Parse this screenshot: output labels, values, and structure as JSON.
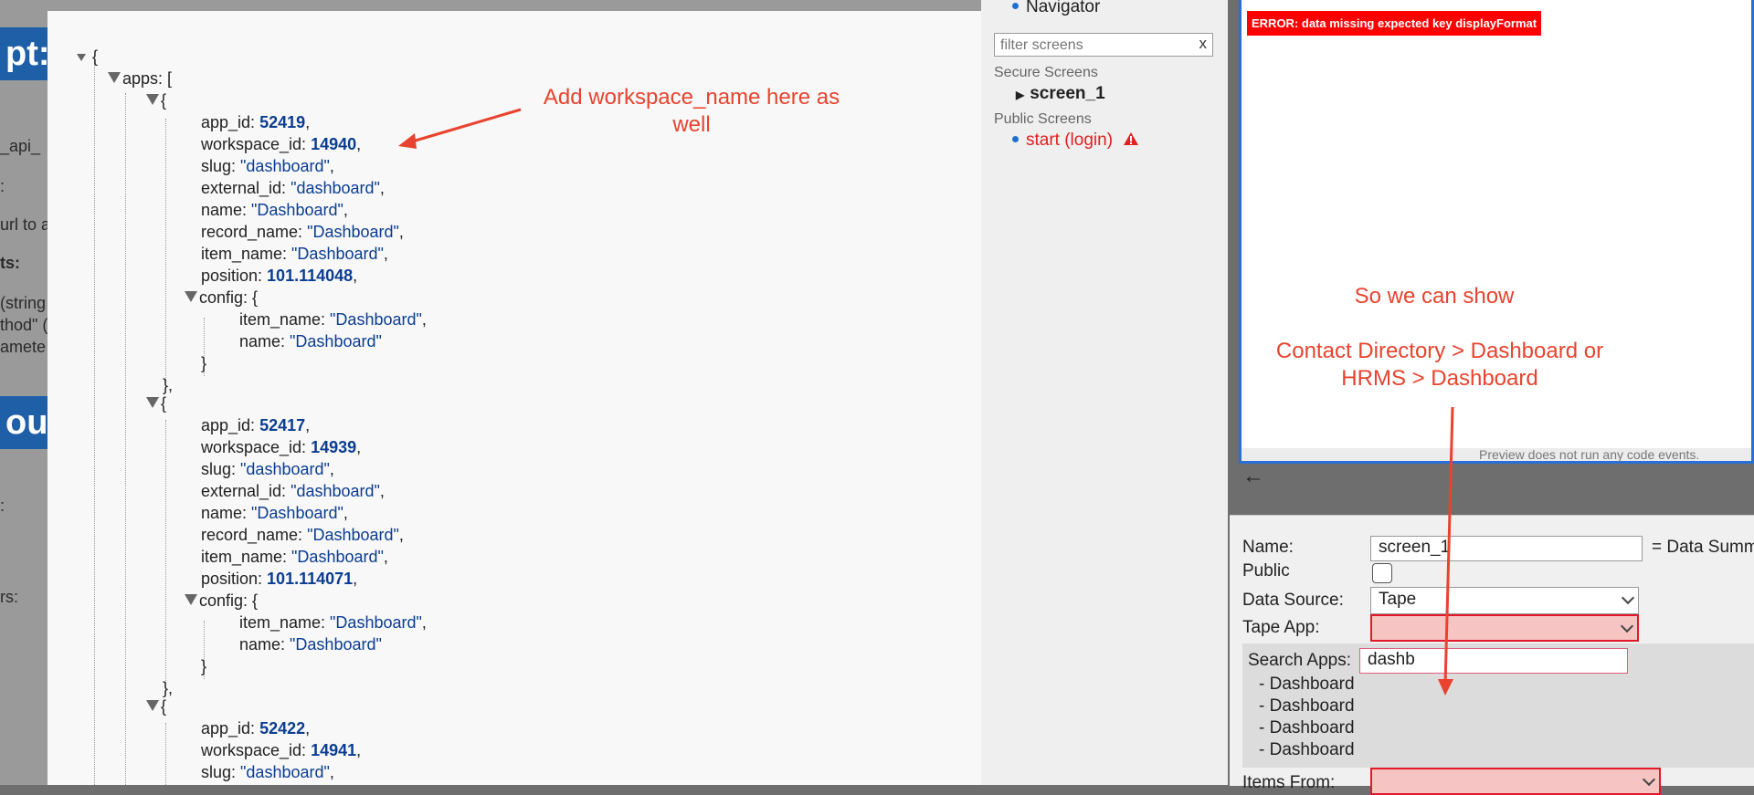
{
  "background": {
    "headings": [
      "pt:",
      "out"
    ],
    "fragments": [
      "_api_",
      ":",
      "url to a",
      "ts:",
      "(string",
      "thod\" (",
      "amete",
      ":",
      "rs:"
    ]
  },
  "json_view": {
    "open_brace": "{",
    "apps_key": "apps: [",
    "records": [
      {
        "app_id": "52419",
        "workspace_id": "14940",
        "slug": "\"dashboard\"",
        "external_id": "\"dashboard\"",
        "name": "\"Dashboard\"",
        "record_name": "\"Dashboard\"",
        "item_name": "\"Dashboard\"",
        "position": "101.114048",
        "config_item_name": "\"Dashboard\"",
        "config_name": "\"Dashboard\""
      },
      {
        "app_id": "52417",
        "workspace_id": "14939",
        "slug": "\"dashboard\"",
        "external_id": "\"dashboard\"",
        "name": "\"Dashboard\"",
        "record_name": "\"Dashboard\"",
        "item_name": "\"Dashboard\"",
        "position": "101.114071",
        "config_item_name": "\"Dashboard\"",
        "config_name": "\"Dashboard\""
      },
      {
        "app_id": "52422",
        "workspace_id": "14941",
        "slug": "\"dashboard\""
      }
    ]
  },
  "annotations": {
    "workspace_note_line1": "Add workspace_name here as",
    "workspace_note_line2": "well",
    "show_note": "So we can show",
    "example_line1": "Contact Directory > Dashboard or",
    "example_line2": "HRMS > Dashboard"
  },
  "navigator": {
    "title": "Navigator",
    "filter_placeholder": "filter screens",
    "filter_clear": "x",
    "secure_label": "Secure Screens",
    "secure_screens": [
      "screen_1"
    ],
    "public_label": "Public Screens",
    "public_screens": [
      "start (login)"
    ],
    "warning_icon": "warning-icon"
  },
  "preview": {
    "error": "ERROR: data missing expected key displayFormat",
    "footer": "Preview does not run any code events."
  },
  "properties": {
    "name_label": "Name:",
    "name_value": "screen_1",
    "name_suffix": "= Data Summ",
    "public_label": "Public",
    "data_source_label": "Data Source:",
    "data_source_value": "Tape",
    "tape_app_label": "Tape App:",
    "search_apps_label": "Search Apps:",
    "search_apps_value": "dashb",
    "results": [
      "- Dashboard",
      "- Dashboard",
      "- Dashboard",
      "- Dashboard"
    ],
    "items_from_label": "Items From:"
  },
  "colors": {
    "annotation": "#e8432e",
    "error_bg": "#ff0000",
    "accent": "#2a6fd6",
    "invalid_bg": "#f7c4c4"
  }
}
